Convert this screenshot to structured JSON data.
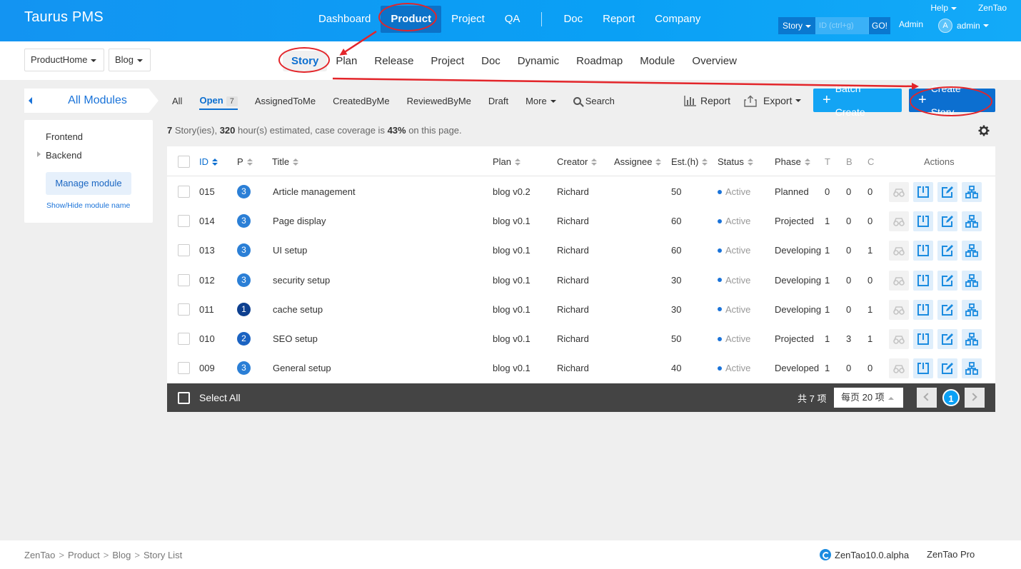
{
  "header": {
    "brand": "Taurus PMS",
    "nav": [
      {
        "label": "Dashboard",
        "active": false
      },
      {
        "label": "Product",
        "active": true
      },
      {
        "label": "Project",
        "active": false
      },
      {
        "label": "QA",
        "active": false
      },
      {
        "label": "Doc",
        "active": false
      },
      {
        "label": "Report",
        "active": false
      },
      {
        "label": "Company",
        "active": false
      }
    ],
    "help": "Help",
    "zentao": "ZenTao",
    "search_type": "Story",
    "search_placeholder": "ID (ctrl+g)",
    "search_go": "GO!",
    "role": "Admin",
    "avatar_letter": "A",
    "user": "admin"
  },
  "subheader": {
    "crumbs": [
      "ProductHome",
      "Blog"
    ],
    "nav": [
      {
        "label": "Story",
        "active": true
      },
      {
        "label": "Plan",
        "active": false
      },
      {
        "label": "Release",
        "active": false
      },
      {
        "label": "Project",
        "active": false
      },
      {
        "label": "Doc",
        "active": false
      },
      {
        "label": "Dynamic",
        "active": false
      },
      {
        "label": "Roadmap",
        "active": false
      },
      {
        "label": "Module",
        "active": false
      },
      {
        "label": "Overview",
        "active": false
      }
    ]
  },
  "sidebar": {
    "title": "All Modules",
    "modules": [
      "Frontend",
      "Backend"
    ],
    "manage": "Manage module",
    "showhide": "Show/Hide module name"
  },
  "filters": {
    "items": [
      "All",
      "Open",
      "AssignedToMe",
      "CreatedByMe",
      "ReviewedByMe",
      "Draft"
    ],
    "open_count": "7",
    "more": "More",
    "search": "Search",
    "report": "Report",
    "export": "Export",
    "batch_create": "Batch Create",
    "create_story": "Create Story"
  },
  "summary": {
    "count": "7",
    "count_text": " Story(ies), ",
    "hours": "320",
    "hours_text": " hour(s) estimated, case coverage is ",
    "coverage": "43%",
    "tail": " on this page."
  },
  "table": {
    "columns": [
      "ID",
      "P",
      "Title",
      "Plan",
      "Creator",
      "Assignee",
      "Est.(h)",
      "Status",
      "Phase",
      "T",
      "B",
      "C",
      "Actions"
    ],
    "rows": [
      {
        "id": "015",
        "pri": "3",
        "title": "Article management",
        "plan": "blog v0.2",
        "creator": "Richard",
        "assignee": "",
        "est": "50",
        "status": "Active",
        "phase": "Planned",
        "t": "0",
        "b": "0",
        "c": "0"
      },
      {
        "id": "014",
        "pri": "3",
        "title": "Page display",
        "plan": "blog v0.1",
        "creator": "Richard",
        "assignee": "",
        "est": "60",
        "status": "Active",
        "phase": "Projected",
        "t": "1",
        "b": "0",
        "c": "0"
      },
      {
        "id": "013",
        "pri": "3",
        "title": "UI setup",
        "plan": "blog v0.1",
        "creator": "Richard",
        "assignee": "",
        "est": "60",
        "status": "Active",
        "phase": "Developing",
        "t": "1",
        "b": "0",
        "c": "1"
      },
      {
        "id": "012",
        "pri": "3",
        "title": "security setup",
        "plan": "blog v0.1",
        "creator": "Richard",
        "assignee": "",
        "est": "30",
        "status": "Active",
        "phase": "Developing",
        "t": "1",
        "b": "0",
        "c": "0"
      },
      {
        "id": "011",
        "pri": "1",
        "title": "cache setup",
        "plan": "blog v0.1",
        "creator": "Richard",
        "assignee": "",
        "est": "30",
        "status": "Active",
        "phase": "Developing",
        "t": "1",
        "b": "0",
        "c": "1"
      },
      {
        "id": "010",
        "pri": "2",
        "title": "SEO setup",
        "plan": "blog v0.1",
        "creator": "Richard",
        "assignee": "",
        "est": "50",
        "status": "Active",
        "phase": "Projected",
        "t": "1",
        "b": "3",
        "c": "1"
      },
      {
        "id": "009",
        "pri": "3",
        "title": "General setup",
        "plan": "blog v0.1",
        "creator": "Richard",
        "assignee": "",
        "est": "40",
        "status": "Active",
        "phase": "Developed",
        "t": "1",
        "b": "0",
        "c": "0"
      }
    ],
    "select_all": "Select All",
    "total": "共 7 项",
    "per_page": "每页 20 项",
    "current_page": "1"
  },
  "footer": {
    "crumbs": [
      "ZenTao",
      "Product",
      "Blog",
      "Story List"
    ],
    "version": "ZenTao10.0.alpha",
    "pro": "ZenTao Pro"
  },
  "colors": {
    "header_blue": "#0aa0f5",
    "accent": "#0c6fd0",
    "annotation_red": "#e3252a",
    "pri1": "#0d3f8f",
    "pri2": "#1b63c2",
    "pri3": "#2b7fd6"
  }
}
